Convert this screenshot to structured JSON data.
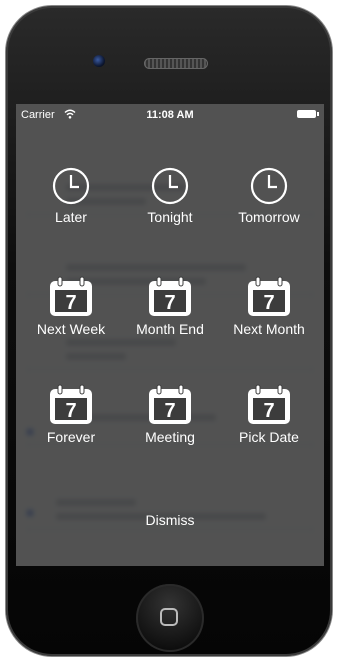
{
  "status_bar": {
    "carrier": "Carrier",
    "time": "11:08 AM"
  },
  "options": [
    {
      "label": "Later",
      "icon": "clock-icon"
    },
    {
      "label": "Tonight",
      "icon": "clock-icon"
    },
    {
      "label": "Tomorrow",
      "icon": "clock-icon"
    },
    {
      "label": "Next Week",
      "icon": "calendar-icon",
      "day": "7"
    },
    {
      "label": "Month End",
      "icon": "calendar-icon",
      "day": "7"
    },
    {
      "label": "Next Month",
      "icon": "calendar-icon",
      "day": "7"
    },
    {
      "label": "Forever",
      "icon": "calendar-icon",
      "day": "7"
    },
    {
      "label": "Meeting",
      "icon": "calendar-icon",
      "day": "7"
    },
    {
      "label": "Pick Date",
      "icon": "calendar-icon",
      "day": "7"
    }
  ],
  "dismiss_label": "Dismiss",
  "colors": {
    "overlay": "#3c3c3c",
    "text": "#ffffff",
    "phone_body": "#0d0d0d"
  }
}
